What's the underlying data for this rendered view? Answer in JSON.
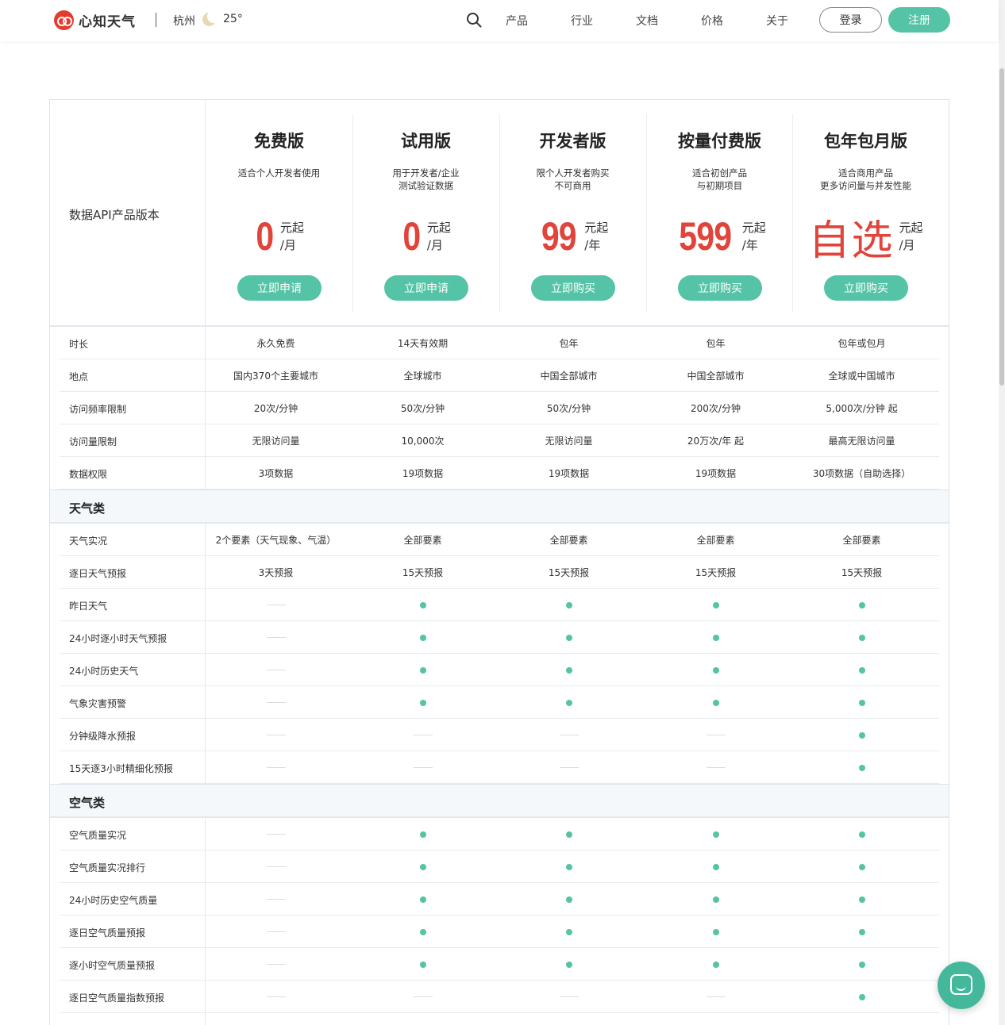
{
  "header": {
    "logo_text": "心知天气",
    "city": "杭州",
    "temperature": "25°",
    "nav": [
      "产品",
      "行业",
      "文档",
      "价格",
      "关于"
    ],
    "login": "登录",
    "register": "注册",
    "colors": {
      "accent": "#55c3a5",
      "price": "#e0443a",
      "logo": "#e63a2e"
    }
  },
  "hero": {
    "label": "数据API产品版本",
    "plans": [
      {
        "name": "免费版",
        "desc1": "适合个人开发者使用",
        "desc2": "",
        "price": "0",
        "unit_top": "元起",
        "unit_bottom": "/月",
        "button": "立即申请"
      },
      {
        "name": "试用版",
        "desc1": "用于开发者/企业",
        "desc2": "测试验证数据",
        "price": "0",
        "unit_top": "元起",
        "unit_bottom": "/月",
        "button": "立即申请"
      },
      {
        "name": "开发者版",
        "desc1": "限个人开发者购买",
        "desc2": "不可商用",
        "price": "99",
        "unit_top": "元起",
        "unit_bottom": "/年",
        "button": "立即购买"
      },
      {
        "name": "按量付费版",
        "desc1": "适合初创产品",
        "desc2": "与初期项目",
        "price": "599",
        "unit_top": "元起",
        "unit_bottom": "/年",
        "button": "立即购买"
      },
      {
        "name": "包年包月版",
        "desc1": "适合商用产品",
        "desc2": "更多访问量与并发性能",
        "price": "自选",
        "unit_top": "元起",
        "unit_bottom": "/月",
        "button": "立即购买"
      }
    ]
  },
  "basic_rows": [
    {
      "label": "时长",
      "cells": [
        "永久免费",
        "14天有效期",
        "包年",
        "包年",
        "包年或包月"
      ]
    },
    {
      "label": "地点",
      "cells": [
        "国内370个主要城市",
        "全球城市",
        "中国全部城市",
        "中国全部城市",
        "全球或中国城市"
      ]
    },
    {
      "label": "访问频率限制",
      "cells": [
        "20次/分钟",
        "50次/分钟",
        "50次/分钟",
        "200次/分钟",
        "5,000次/分钟 起"
      ]
    },
    {
      "label": "访问量限制",
      "cells": [
        "无限访问量",
        "10,000次",
        "无限访问量",
        "20万次/年 起",
        "最高无限访问量"
      ]
    },
    {
      "label": "数据权限",
      "cells": [
        "3项数据",
        "19项数据",
        "19项数据",
        "19项数据",
        "30项数据（自助选择）"
      ]
    }
  ],
  "weather_section": {
    "title": "天气类",
    "rows": [
      {
        "label": "天气实况",
        "cells": [
          "2个要素（天气现象、气温）",
          "全部要素",
          "全部要素",
          "全部要素",
          "全部要素"
        ]
      },
      {
        "label": "逐日天气预报",
        "cells": [
          "3天预报",
          "15天预报",
          "15天预报",
          "15天预报",
          "15天预报"
        ]
      },
      {
        "label": "昨日天气",
        "cells": [
          "-",
          "•",
          "•",
          "•",
          "•"
        ]
      },
      {
        "label": "24小时逐小时天气预报",
        "cells": [
          "-",
          "•",
          "•",
          "•",
          "•"
        ]
      },
      {
        "label": "24小时历史天气",
        "cells": [
          "-",
          "•",
          "•",
          "•",
          "•"
        ]
      },
      {
        "label": "气象灾害预警",
        "cells": [
          "-",
          "•",
          "•",
          "•",
          "•"
        ]
      },
      {
        "label": "分钟级降水预报",
        "cells": [
          "-",
          "-",
          "-",
          "-",
          "•"
        ]
      },
      {
        "label": "15天逐3小时精细化预报",
        "cells": [
          "-",
          "-",
          "-",
          "-",
          "•"
        ]
      }
    ]
  },
  "air_section": {
    "title": "空气类",
    "rows": [
      {
        "label": "空气质量实况",
        "cells": [
          "-",
          "•",
          "•",
          "•",
          "•"
        ]
      },
      {
        "label": "空气质量实况排行",
        "cells": [
          "-",
          "•",
          "•",
          "•",
          "•"
        ]
      },
      {
        "label": "24小时历史空气质量",
        "cells": [
          "-",
          "•",
          "•",
          "•",
          "•"
        ]
      },
      {
        "label": "逐日空气质量预报",
        "cells": [
          "-",
          "•",
          "•",
          "•",
          "•"
        ]
      },
      {
        "label": "逐小时空气质量预报",
        "cells": [
          "-",
          "•",
          "•",
          "•",
          "•"
        ]
      },
      {
        "label": "逐日空气质量指数预报",
        "cells": [
          "-",
          "-",
          "-",
          "-",
          "•"
        ]
      },
      {
        "label": "",
        "cells": [
          "",
          "",
          "",
          "",
          ""
        ]
      }
    ]
  }
}
